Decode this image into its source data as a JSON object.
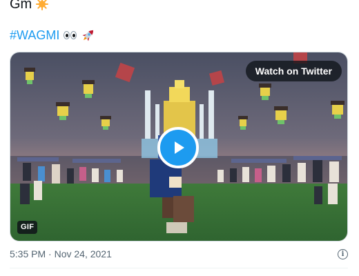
{
  "tweet": {
    "line1_text": "Gm",
    "line1_emoji": "sun-icon",
    "hashtag": "#WAGMI",
    "hashtag_emojis": [
      "eyes-icon",
      "rocket-icon"
    ],
    "timestamp": "5:35 PM · Nov 24, 2021"
  },
  "media": {
    "watch_label": "Watch on Twitter",
    "badge": "GIF",
    "play_icon": "play-icon",
    "info_icon": "info-icon"
  },
  "colors": {
    "link": "#1d9bf0",
    "text": "#0f1419",
    "muted": "#536471",
    "play": "#1d9bf0"
  }
}
